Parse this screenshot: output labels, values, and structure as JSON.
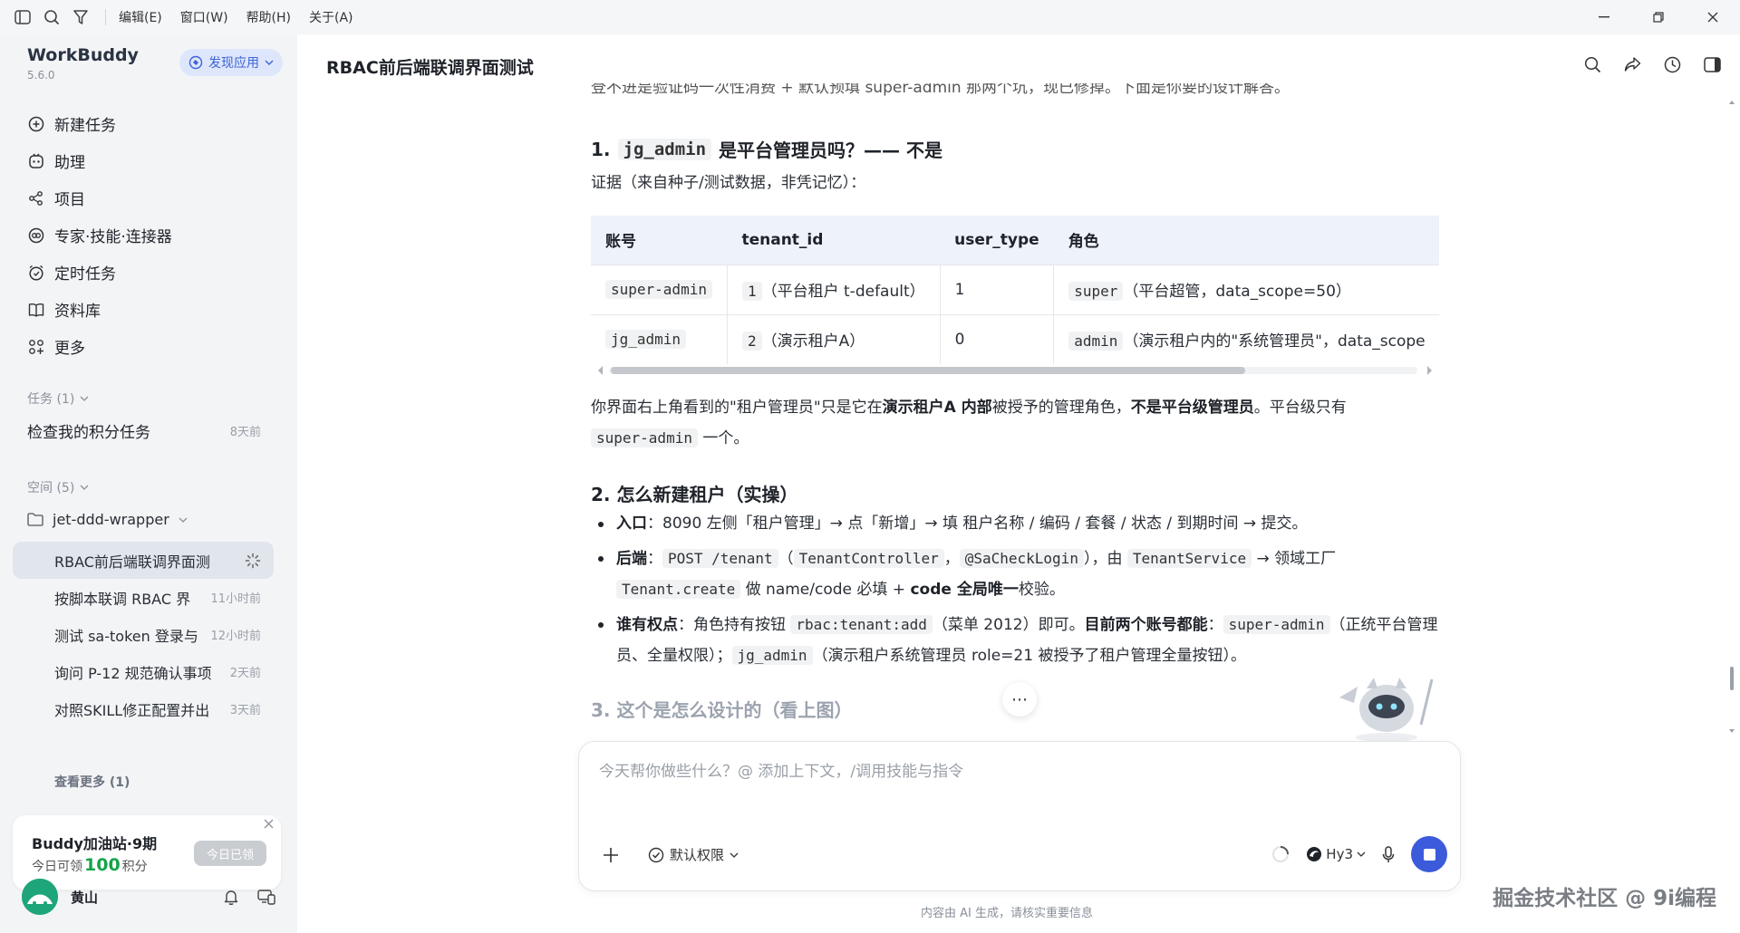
{
  "menubar": {
    "items": [
      "编辑(E)",
      "窗口(W)",
      "帮助(H)",
      "关于(A)"
    ]
  },
  "sidebar": {
    "brand": "WorkBuddy",
    "version": "5.6.0",
    "discover_label": "发现应用",
    "nav": [
      "新建任务",
      "助理",
      "项目",
      "专家·技能·连接器",
      "定时任务",
      "资料库",
      "更多"
    ],
    "tasks_header": "任务 (1)",
    "task": {
      "title": "检查我的积分任务",
      "time": "8天前"
    },
    "spaces_header": "空间 (5)",
    "folder": "jet-ddd-wrapper",
    "sessions": [
      {
        "title": "RBAC前后端联调界面测",
        "time": ""
      },
      {
        "title": "按脚本联调 RBAC 界",
        "time": "11小时前"
      },
      {
        "title": "测试 sa-token 登录与",
        "time": "12小时前"
      },
      {
        "title": "询问 P-12 规范确认事项",
        "time": "2天前"
      },
      {
        "title": "对照SKILL修正配置并出",
        "time": "3天前"
      }
    ],
    "see_more": "查看更多 (1)",
    "promo": {
      "title": "Buddy加油站·9期",
      "sub_prefix": "今日可领",
      "sub_num": "100",
      "sub_suffix": "积分",
      "button": "今日已领"
    },
    "user": "黄山"
  },
  "main": {
    "title": "RBAC前后端联调界面测试",
    "cut_line": "登不进是验证码一次性消费 + 默认预填 super-admin 那两个坑，现已修掉。下面是你要的设计解答。",
    "h1_code": "jg_admin",
    "h1_text": "是平台管理员吗？—— 不是",
    "evidence": "证据（来自种子/测试数据，非凭记忆）：",
    "table": {
      "headers": [
        "账号",
        "tenant_id",
        "user_type",
        "角色"
      ],
      "rows": [
        {
          "account": "super-admin",
          "tid_code": "1",
          "tid_text": "（平台租户 t-default）",
          "user_type": "1",
          "role_code": "super",
          "role_text": "（平台超管，data_scope=50）"
        },
        {
          "account": "jg_admin",
          "tid_code": "2",
          "tid_text": "（演示租户A）",
          "user_type": "0",
          "role_code": "admin",
          "role_text": "（演示租户内的\"系统管理员\"，data_scope"
        }
      ]
    },
    "para1": {
      "a": "你界面右上角看到的\"租户管理员\"只是它在",
      "b": "演示租户A 内部",
      "c": "被授予的管理角色，",
      "d": "不是平台级管理员",
      "e": "。平台级只有",
      "code": "super-admin",
      "f": "一个。"
    },
    "h2_text": "2. 怎么新建租户（实操）",
    "bullet1": {
      "label": "入口",
      "text": "：8090 左侧「租户管理」→ 点「新增」→ 填 租户名称 / 编码 / 套餐 / 状态 / 到期时间 → 提交。"
    },
    "bullet2": {
      "label": "后端",
      "c1": "POST /tenant",
      "t1": "（",
      "c2": "TenantController",
      "t2": "，",
      "c3": "@SaCheckLogin",
      "t3": "），由",
      "c4": "TenantService",
      "t4": "→ 领域工厂",
      "c5": "Tenant.create",
      "t5": "做 name/code 必填 +",
      "b1": "code 全局唯一",
      "t6": "校验。"
    },
    "bullet3": {
      "label": "谁有权点",
      "t1": "：角色持有按钮",
      "c1": "rbac:tenant:add",
      "t2": "（菜单 2012）即可。",
      "b1": "目前两个账号都能",
      "t3": "：",
      "c2": "super-admin",
      "t4": "（正统平台管理员、全量权限）；",
      "c3": "jg_admin",
      "t5": "（演示租户系统管理员 role=21 被授予了租户管理全量按钮）。"
    },
    "h3_text": "3. 这个是怎么设计的（看上图）"
  },
  "input": {
    "placeholder": "今天帮你做些什么？@ 添加上下文，/调用技能与指令",
    "permission": "默认权限",
    "model": "Hy3"
  },
  "footer": {
    "disclaimer": "内容由 AI 生成，请核实重要信息",
    "watermark": "掘金技术社区 @ 9i编程"
  }
}
